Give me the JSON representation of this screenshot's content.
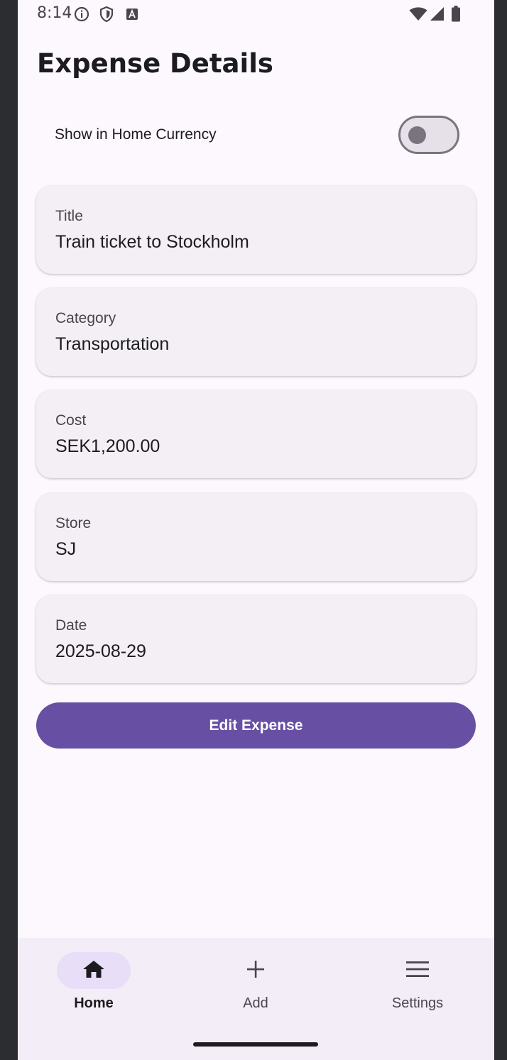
{
  "status_bar": {
    "time": "8:14",
    "left_icons": [
      "info-icon",
      "shield-icon",
      "text-a-icon"
    ],
    "right_icons": [
      "wifi-icon",
      "signal-icon",
      "battery-icon"
    ]
  },
  "header": {
    "title": "Expense Details"
  },
  "toggle": {
    "label": "Show in Home Currency",
    "on": false
  },
  "fields": [
    {
      "label": "Title",
      "value": "Train ticket to Stockholm"
    },
    {
      "label": "Category",
      "value": "Transportation"
    },
    {
      "label": "Cost",
      "value": "SEK1,200.00"
    },
    {
      "label": "Store",
      "value": "SJ"
    },
    {
      "label": "Date",
      "value": "2025-08-29"
    }
  ],
  "actions": {
    "edit_label": "Edit Expense"
  },
  "bottom_nav": {
    "items": [
      {
        "label": "Home",
        "icon": "home-icon",
        "active": true
      },
      {
        "label": "Add",
        "icon": "plus-icon",
        "active": false
      },
      {
        "label": "Settings",
        "icon": "menu-icon",
        "active": false
      }
    ]
  },
  "colors": {
    "primary": "#6750a4",
    "surface": "#fcf8fd",
    "card": "#f3eff5",
    "nav_background": "#f3edf7",
    "nav_indicator": "#e8def8"
  }
}
